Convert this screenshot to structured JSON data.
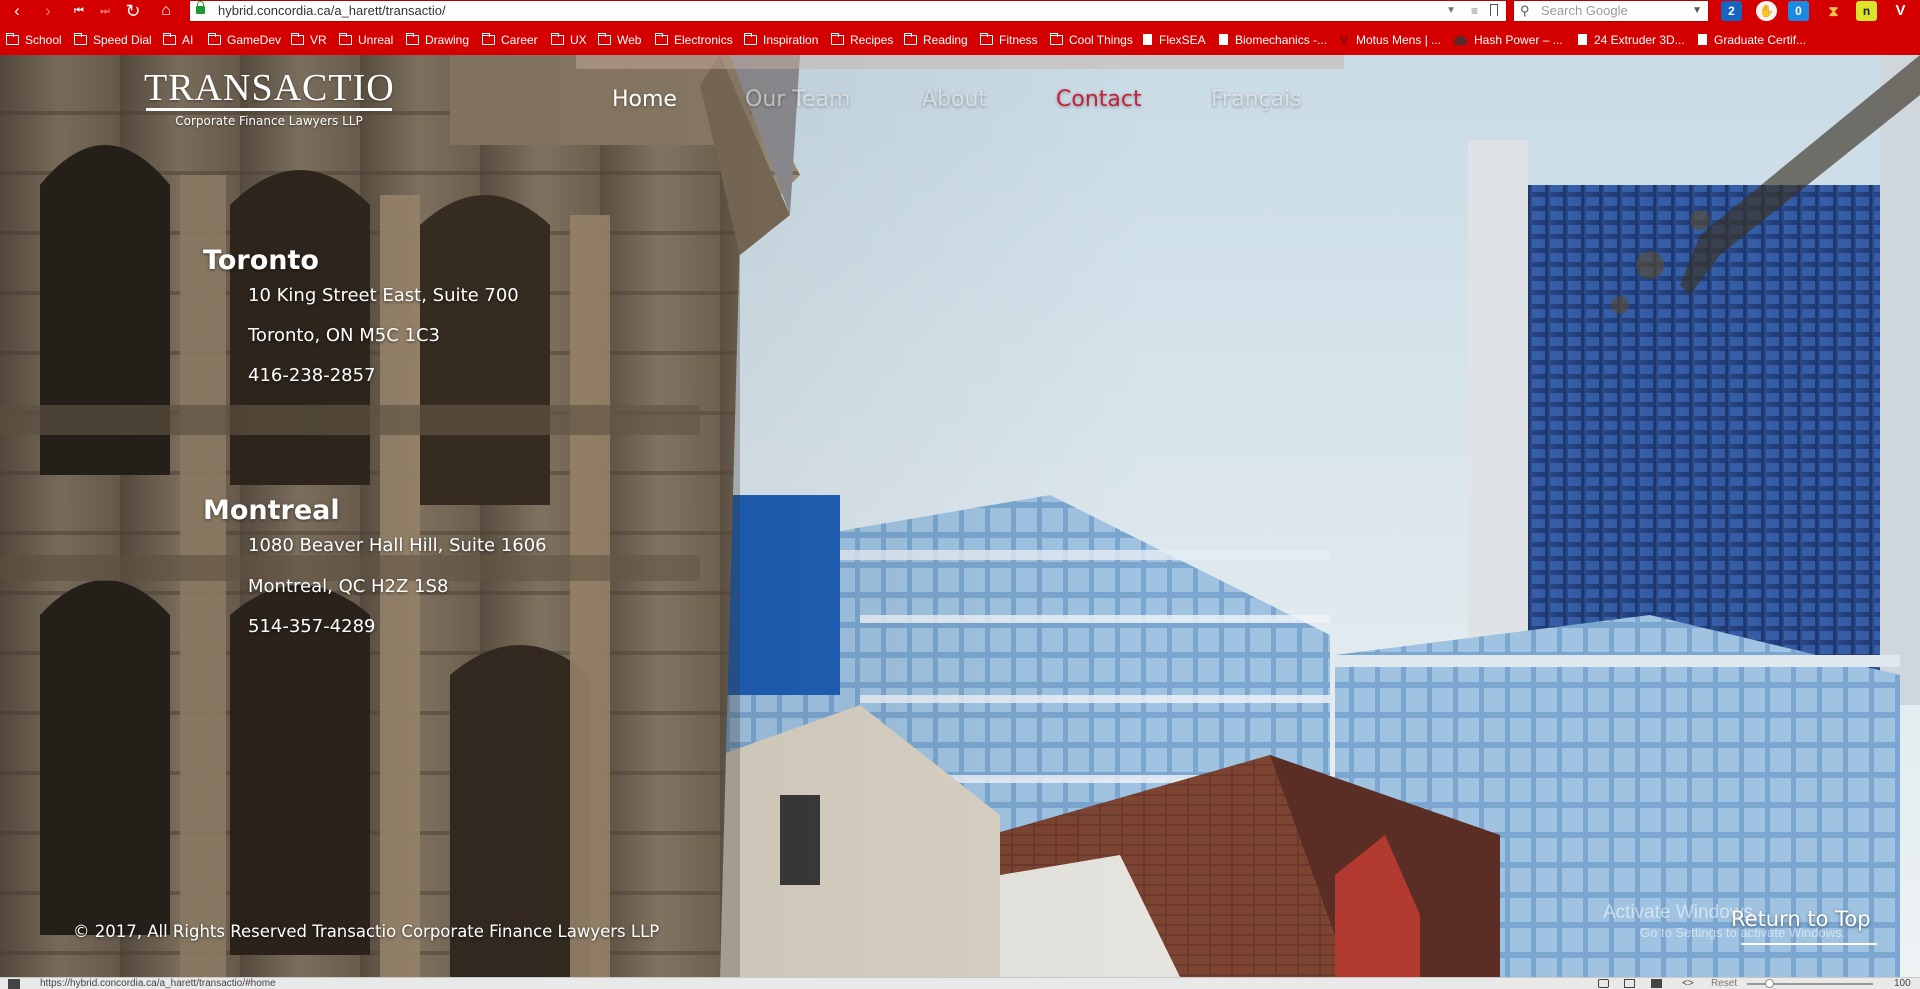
{
  "browser": {
    "url": "hybrid.concordia.ca/a_harett/transactio/",
    "search_placeholder": "Search Google",
    "status_url": "https://hybrid.concordia.ca/a_harett/transactio/#home",
    "status_reset": "Reset",
    "zoom_level": "100 %",
    "extension_badges": [
      "2",
      "0"
    ],
    "bookmarks": [
      {
        "label": "School",
        "type": "folder"
      },
      {
        "label": "Speed Dial",
        "type": "folder"
      },
      {
        "label": "AI",
        "type": "folder"
      },
      {
        "label": "GameDev",
        "type": "folder"
      },
      {
        "label": "VR",
        "type": "folder"
      },
      {
        "label": "Unreal",
        "type": "folder"
      },
      {
        "label": "Drawing",
        "type": "folder"
      },
      {
        "label": "Career",
        "type": "folder"
      },
      {
        "label": "UX",
        "type": "folder"
      },
      {
        "label": "Web",
        "type": "folder"
      },
      {
        "label": "Electronics",
        "type": "folder"
      },
      {
        "label": "Inspiration",
        "type": "folder"
      },
      {
        "label": "Recipes",
        "type": "folder"
      },
      {
        "label": "Reading",
        "type": "folder"
      },
      {
        "label": "Fitness",
        "type": "folder"
      },
      {
        "label": "Cool Things",
        "type": "folder"
      },
      {
        "label": "FlexSEA",
        "type": "page"
      },
      {
        "label": "Biomechanics -...",
        "type": "page"
      },
      {
        "label": "Motus Mens | ...",
        "type": "site"
      },
      {
        "label": "Hash Power – ...",
        "type": "site-dark"
      },
      {
        "label": "24 Extruder 3D...",
        "type": "page"
      },
      {
        "label": "Graduate Certif...",
        "type": "page"
      }
    ],
    "accent_color": "#d40000"
  },
  "site": {
    "logo_title": "TRANSACTIO",
    "logo_subtitle": "Corporate Finance Lawyers LLP",
    "nav": [
      {
        "label": "Home",
        "state": "default"
      },
      {
        "label": "Our Team",
        "state": "faint"
      },
      {
        "label": "About",
        "state": "faint"
      },
      {
        "label": "Contact",
        "state": "active"
      },
      {
        "label": "Français",
        "state": "faint"
      }
    ],
    "active_color": "#c4213b",
    "offices": [
      {
        "city": "Toronto",
        "street": "10 King Street East, Suite 700",
        "city_line": "Toronto, ON M5C 1C3",
        "phone": "416-238-2857"
      },
      {
        "city": "Montreal",
        "street": "1080 Beaver Hall Hill, Suite 1606",
        "city_line": "Montreal, QC H2Z 1S8",
        "phone": "514-357-4289"
      }
    ],
    "copyright": "© 2017, All Rights Reserved Transactio Corporate Finance Lawyers LLP",
    "return_to_top": "Return to Top",
    "watermark_title": "Activate Windows",
    "watermark_subtitle": "Go to Settings to activate Windows."
  }
}
